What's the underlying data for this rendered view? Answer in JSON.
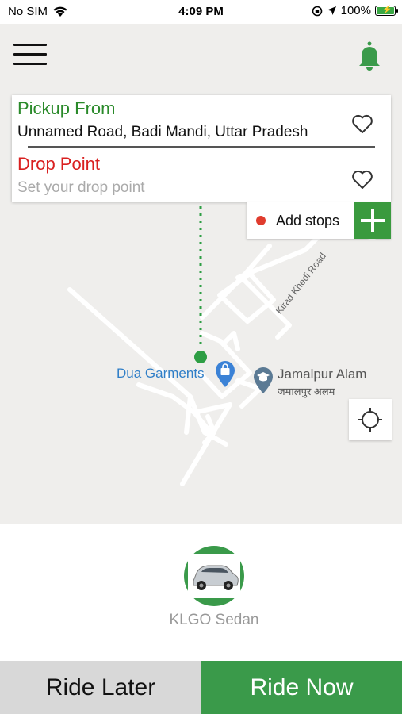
{
  "status_bar": {
    "carrier": "No SIM",
    "time": "4:09 PM",
    "battery": "100%",
    "icons": [
      "wifi-icon",
      "orientation-lock-icon",
      "location-arrow-icon",
      "battery-charging-icon"
    ]
  },
  "header": {
    "menu_icon": "hamburger-menu-icon",
    "notification_icon": "bell-icon"
  },
  "address_card": {
    "pickup_label": "Pickup From",
    "pickup_value": "Unnamed Road, Badi Mandi, Uttar Pradesh",
    "drop_label": "Drop Point",
    "drop_placeholder": "Set your drop point",
    "favorite_icon": "heart-icon"
  },
  "add_stops": {
    "label": "Add stops",
    "icon": "plus-icon"
  },
  "map": {
    "pois": [
      {
        "name": "Dua Garments",
        "icon": "shopping-bag-pin-icon"
      },
      {
        "name": "Jamalpur Alam",
        "subname": "जमालपुर अलम",
        "icon": "graduation-cap-pin-icon"
      }
    ],
    "road_label": "Kirad Khedi Road",
    "locate_icon": "crosshair-icon"
  },
  "vehicle": {
    "name": "KLGO Sedan",
    "icon": "sedan-car-icon"
  },
  "actions": {
    "ride_later": "Ride Later",
    "ride_now": "Ride Now"
  },
  "colors": {
    "brand_green": "#3a9a4a",
    "pickup_green": "#2a8a2a",
    "drop_red": "#d92020",
    "stop_dot_red": "#e03c2e"
  }
}
